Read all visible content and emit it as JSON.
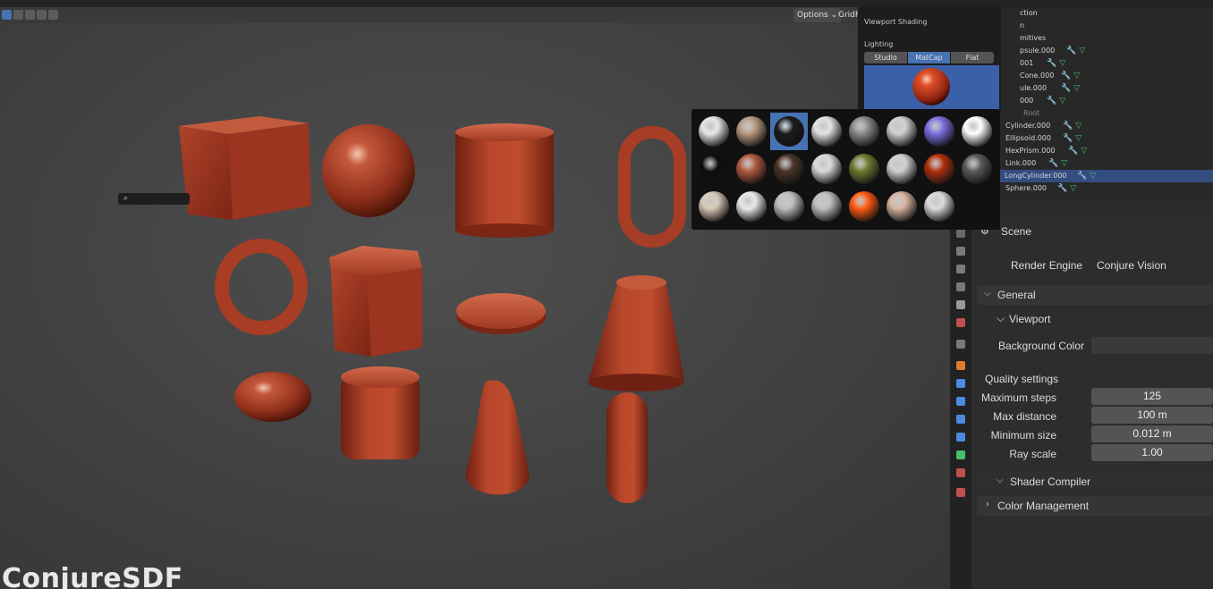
{
  "header": {
    "options_label": "Options",
    "gridfill_label": "GridF"
  },
  "viewport": {
    "watermark": "ConjureSDF",
    "shape_color": "#a13a22"
  },
  "shading_popover": {
    "title": "Viewport Shading",
    "lighting_label": "Lighting",
    "modes": [
      "Studio",
      "MatCap",
      "Flat"
    ],
    "active_mode": "MatCap",
    "preview_bg": "#3b60a8"
  },
  "matcaps": {
    "selected_index": 2,
    "items": [
      "#e6e6e6",
      "#b79a80",
      "#1c1c1c",
      "#e2e2e2",
      "#8a8a8a",
      "#cfcfcf",
      "#7a6fe0",
      "#ffffff",
      "#0e0e0e",
      "#b25a40",
      "#4b3528",
      "#d9d9d9",
      "#6f7a30",
      "#cfcfcf",
      "#b3300f",
      "#5a5a5a",
      "#d8c8b8",
      "#e8e8e8",
      "#bdbdbd",
      "#bdbdbd",
      "#ff5a10",
      "#d5b3a0",
      "#d9d9d9"
    ]
  },
  "outliner": {
    "partial_rows": [
      "ction",
      "n",
      "mitives",
      "psule.000",
      "001",
      "Cone.000",
      "ule.000",
      "000",
      "Root"
    ],
    "rows": [
      "Cylinder.000",
      "Ellipsoid.000",
      "HexPrism.000",
      "Link.000",
      "LongCylinder.000",
      "Sphere.000"
    ],
    "selected": "LongCylinder.000"
  },
  "properties": {
    "context": "Scene",
    "render_engine_label": "Render Engine",
    "render_engine_value": "Conjure Vision",
    "general_label": "General",
    "viewport_label": "Viewport",
    "background_color_label": "Background Color",
    "quality_settings_label": "Quality settings",
    "fields": [
      {
        "label": "Maximum steps",
        "value": "125"
      },
      {
        "label": "Max distance",
        "value": "100 m"
      },
      {
        "label": "Minimum size",
        "value": "0.012 m"
      },
      {
        "label": "Ray scale",
        "value": "1.00"
      }
    ],
    "shader_compiler_label": "Shader Compiler",
    "color_management_label": "Color Management"
  }
}
